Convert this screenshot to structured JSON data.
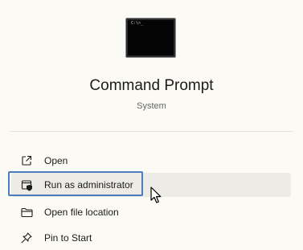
{
  "app": {
    "title": "Command Prompt",
    "subtitle": "System",
    "icon_prompt": "C:\\>_"
  },
  "menu": {
    "items": [
      {
        "label": "Open",
        "icon": "open-external-icon"
      },
      {
        "label": "Run as administrator",
        "icon": "shield-admin-icon"
      },
      {
        "label": "Open file location",
        "icon": "folder-icon"
      },
      {
        "label": "Pin to Start",
        "icon": "pin-icon"
      }
    ]
  },
  "colors": {
    "background": "#fbfaf4",
    "highlight_border": "#4a7cc0",
    "hover_background": "#ecebe6"
  }
}
